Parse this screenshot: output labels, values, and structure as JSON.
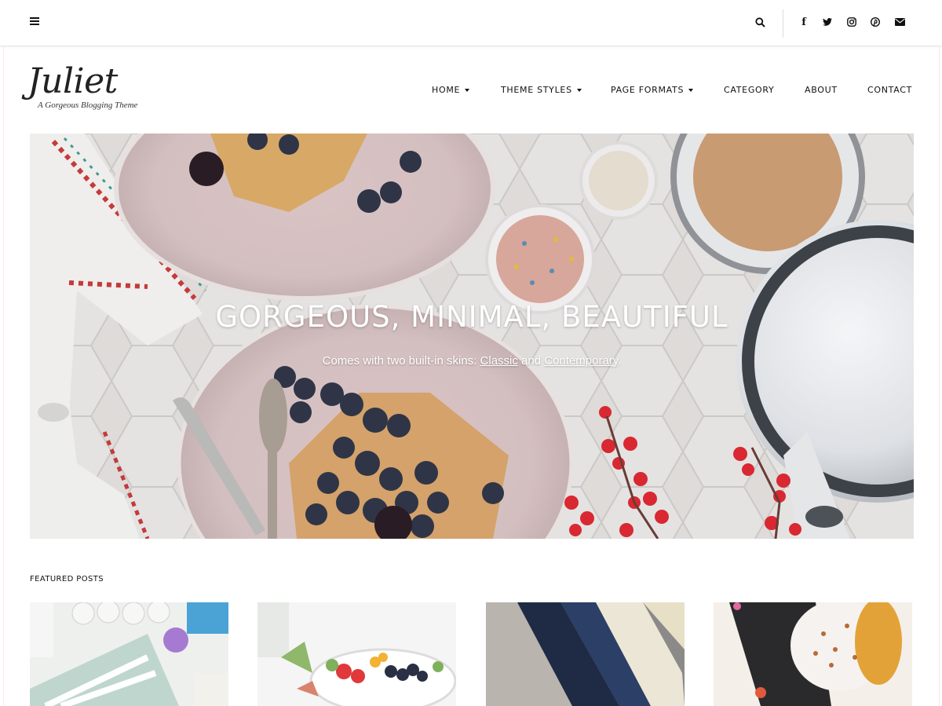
{
  "topbar": {
    "menu_icon": "hamburger-menu-icon",
    "search_icon": "search-icon",
    "social": [
      {
        "icon": "facebook-icon"
      },
      {
        "icon": "twitter-icon"
      },
      {
        "icon": "instagram-icon"
      },
      {
        "icon": "pinterest-icon"
      },
      {
        "icon": "email-icon"
      }
    ]
  },
  "site": {
    "title": "Juliet",
    "tagline": "A Gorgeous Blogging Theme"
  },
  "nav": {
    "items": [
      {
        "label": "HOME",
        "has_dropdown": true
      },
      {
        "label": "THEME STYLES",
        "has_dropdown": true
      },
      {
        "label": "PAGE FORMATS",
        "has_dropdown": true
      },
      {
        "label": "CATEGORY",
        "has_dropdown": false
      },
      {
        "label": "ABOUT",
        "has_dropdown": false
      },
      {
        "label": "CONTACT",
        "has_dropdown": false
      }
    ]
  },
  "hero": {
    "title": "GORGEOUS, MINIMAL, BEAUTIFUL",
    "sub_prefix": "Comes with two built-in skins: ",
    "link1": "Classic",
    "sub_mid": " and ",
    "link2": "Contemporary",
    "sub_suffix": "."
  },
  "featured": {
    "label": "FEATURED POSTS",
    "posts": [
      {
        "image": "stationery-desk-photo"
      },
      {
        "image": "fruit-salad-bowl-photo"
      },
      {
        "image": "stacked-books-photo"
      },
      {
        "image": "sprinkle-donuts-photo"
      }
    ]
  },
  "colors": {
    "text": "#111111",
    "page_border": "#fbe9ee",
    "hero_text": "#ffffff"
  }
}
